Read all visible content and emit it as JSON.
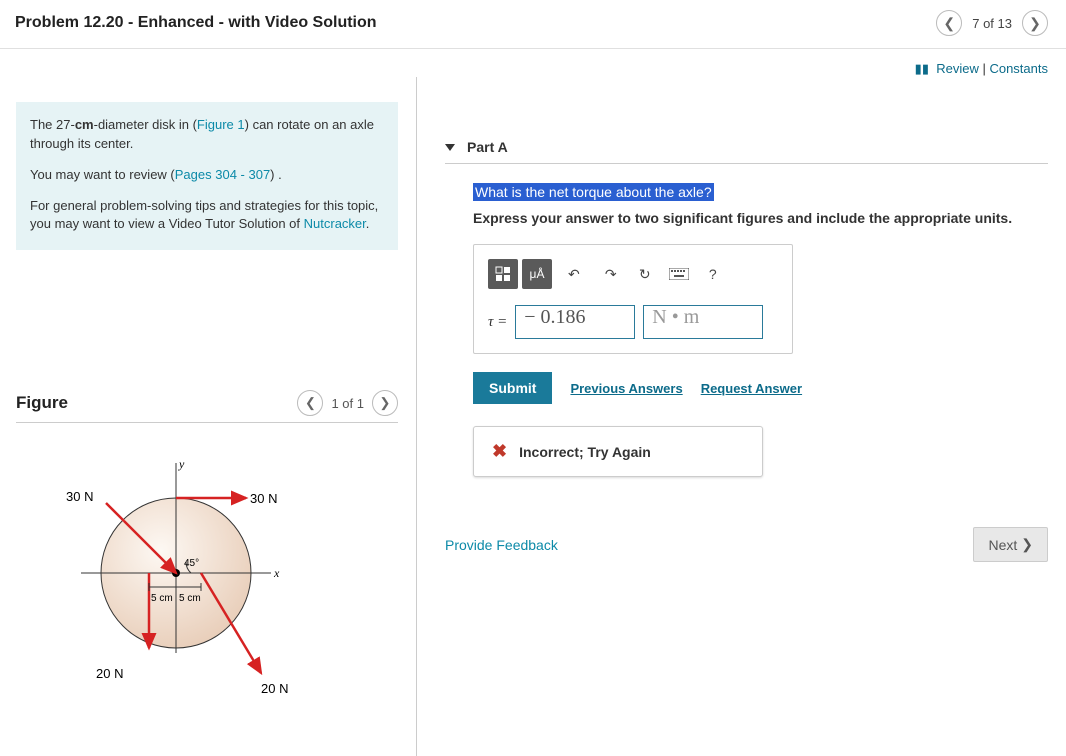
{
  "header": {
    "title": "Problem 12.20 - Enhanced - with Video Solution",
    "page_count": "7 of 13"
  },
  "topright": {
    "review": "Review",
    "constants": "Constants",
    "separator": " | "
  },
  "context": {
    "p1_pre": "The 27-",
    "p1_bold": "cm",
    "p1_mid": "-diameter disk in (",
    "p1_link": "Figure 1",
    "p1_post": ") can rotate on an axle through its center.",
    "p2_pre": "You may want to review (",
    "p2_link": "Pages 304 - 307",
    "p2_post": ") .",
    "p3_pre": "For general problem-solving tips and strategies for this topic, you may want to view a Video Tutor Solution of ",
    "p3_link": "Nutcracker",
    "p3_post": "."
  },
  "figure": {
    "title": "Figure",
    "count": "1 of 1",
    "labels": {
      "y": "y",
      "x": "x",
      "f1": "30 N",
      "f2": "30 N",
      "f3": "20 N",
      "f4": "20 N",
      "angle": "45°",
      "d1": "5 cm",
      "d2": "5 cm"
    }
  },
  "part": {
    "title": "Part A",
    "question": "What is the net torque about the axle?",
    "instruction": "Express your answer to two significant figures and include the appropriate units.",
    "toolbar": {
      "units_btn": "μÅ",
      "help": "?"
    },
    "tau_label": "τ =",
    "value": "− 0.186",
    "unit_placeholder": "N • m",
    "submit": "Submit",
    "prev_answers": "Previous Answers",
    "request_answer": "Request Answer",
    "feedback": "Incorrect; Try Again"
  },
  "footer": {
    "provide": "Provide Feedback",
    "next": "Next"
  }
}
